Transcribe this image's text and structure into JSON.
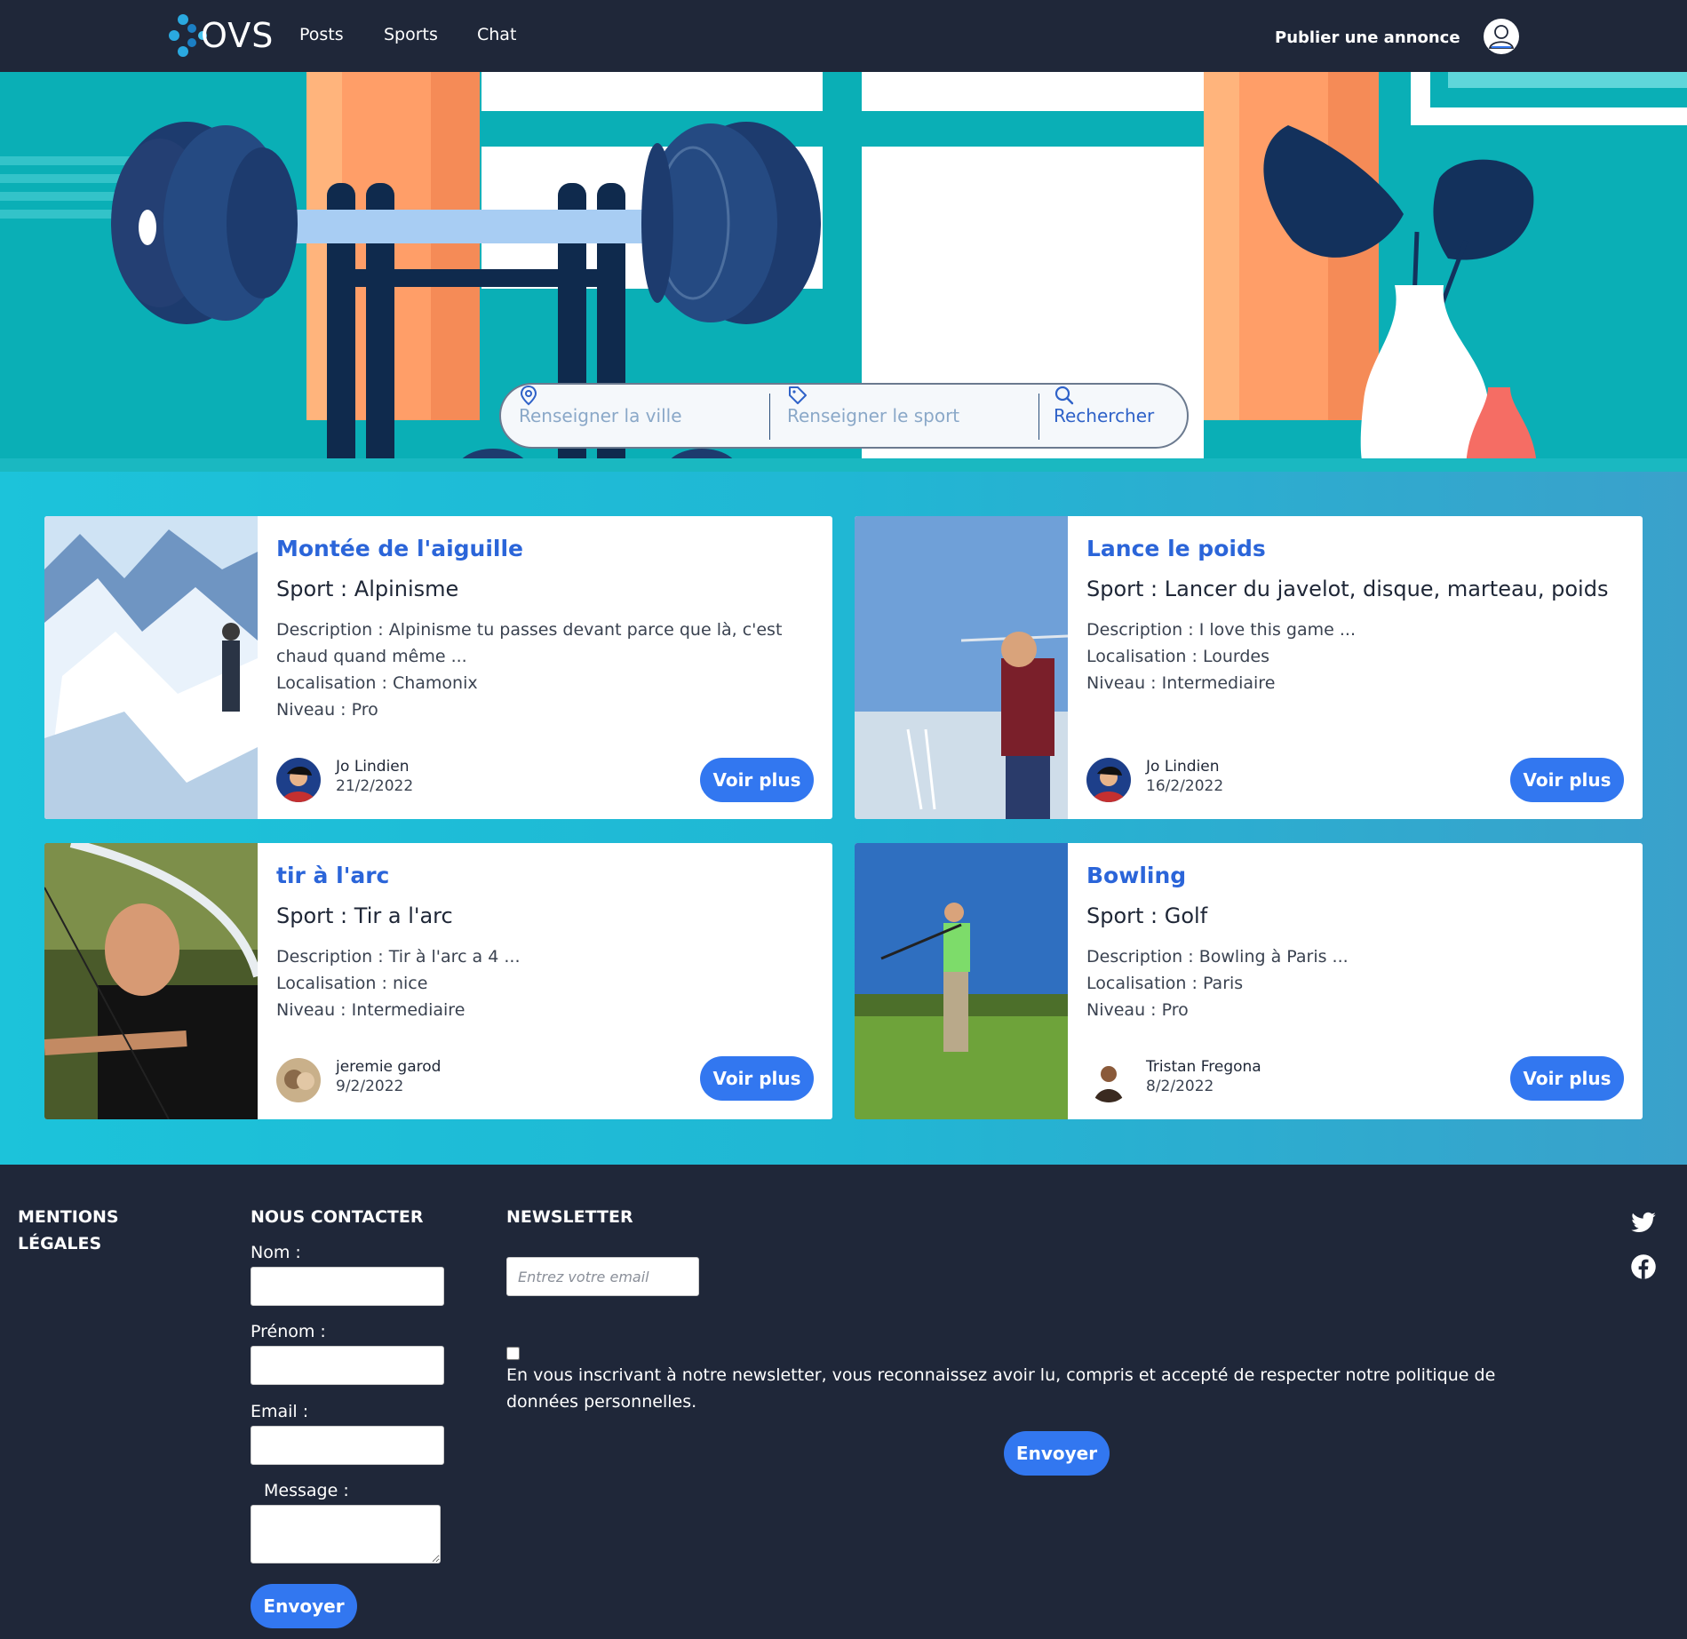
{
  "nav": {
    "logo_text": "OVS",
    "links": [
      "Posts",
      "Sports",
      "Chat"
    ],
    "publish": "Publier une annonce"
  },
  "search": {
    "city_placeholder": "Renseigner la ville",
    "sport_placeholder": "Renseigner le sport",
    "button_label": "Rechercher"
  },
  "posts": [
    {
      "title": "Montée de l'aiguille",
      "sport": "Sport : Alpinisme",
      "description": "Description : Alpinisme tu passes devant parce que là, c'est chaud quand même ...",
      "location": "Localisation : Chamonix",
      "level": "Niveau : Pro",
      "author": "Jo Lindien",
      "date": "21/2/2022",
      "button": "Voir plus"
    },
    {
      "title": "Lance le poids",
      "sport": "Sport : Lancer du javelot, disque, marteau, poids",
      "description": "Description : I love this game ...",
      "location": "Localisation : Lourdes",
      "level": "Niveau : Intermediaire",
      "author": "Jo Lindien",
      "date": "16/2/2022",
      "button": "Voir plus"
    },
    {
      "title": "tir à l'arc",
      "sport": "Sport : Tir a l'arc",
      "description": "Description : Tir à l'arc a 4 ...",
      "location": "Localisation : nice",
      "level": "Niveau : Intermediaire",
      "author": "jeremie garod",
      "date": "9/2/2022",
      "button": "Voir plus"
    },
    {
      "title": "Bowling",
      "sport": "Sport : Golf",
      "description": "Description : Bowling à Paris ...",
      "location": "Localisation : Paris",
      "level": "Niveau : Pro",
      "author": "Tristan Fregona",
      "date": "8/2/2022",
      "button": "Voir plus"
    }
  ],
  "footer": {
    "legal": "MENTIONS LÉGALES",
    "contact": {
      "heading": "NOUS CONTACTER",
      "nom": "Nom :",
      "prenom": "Prénom :",
      "email": "Email :",
      "message": "Message :",
      "submit": "Envoyer"
    },
    "newsletter": {
      "heading": "NEWSLETTER",
      "placeholder": "Entrez votre email",
      "consent": "En vous inscrivant à notre newsletter, vous reconnaissez avoir lu, compris et accepté de respecter notre politique de données personnelles.",
      "submit": "Envoyer"
    },
    "social_icons": [
      "twitter-icon",
      "facebook-icon"
    ]
  },
  "colors": {
    "navy": "#1f2739",
    "accent_blue": "#3277f0",
    "title_blue": "#2b65d9",
    "teal": "#0aafb6"
  }
}
